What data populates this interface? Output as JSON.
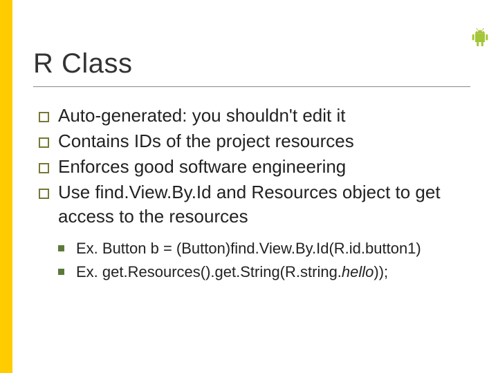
{
  "title": "R Class",
  "bullets": [
    "Auto-generated: you shouldn't edit it",
    "Contains IDs of the project resources",
    "Enforces good software engineering",
    "Use find.View.By.Id and Resources object to get access to the resources"
  ],
  "sub_bullets": [
    {
      "prefix": "Ex. Button b = (Button)find.View.By.Id(R.id.button1)",
      "italic": ""
    },
    {
      "prefix": "Ex. get.Resources().get.String(R.string.",
      "italic": "hello",
      "suffix": "));"
    }
  ],
  "icon": "android-icon"
}
